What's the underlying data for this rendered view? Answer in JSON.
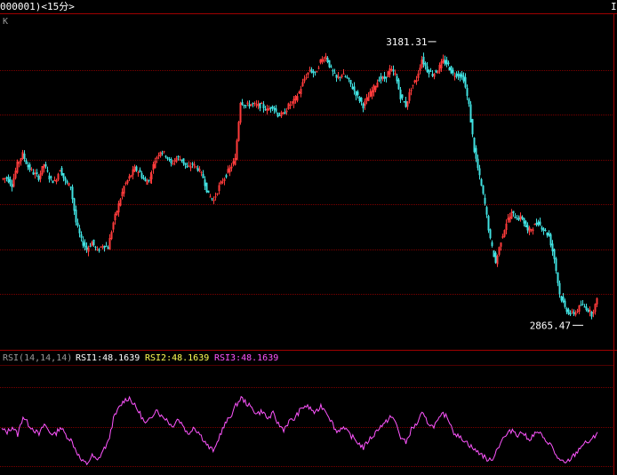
{
  "header": {
    "title": "000001)<15分>",
    "right_marker": "I"
  },
  "price_panel": {
    "label": "K",
    "high_label": "3181.31",
    "low_label": "2865.47"
  },
  "rsi_panel": {
    "params": "RSI(14,14,14)",
    "rsi1": "RSI1:48.1639",
    "rsi2": "RSI2:48.1639",
    "rsi3": "RSI3:48.1639"
  },
  "colors": {
    "background": "#000000",
    "grid": "#7a0000",
    "frame": "#a00000",
    "up_candle": "#ff3b3b",
    "down_candle": "#41e1e1",
    "rsi_line": "#ff55ff",
    "rsi1_text": "#ffffff",
    "rsi2_text": "#ffff55",
    "rsi3_text": "#ff55ff",
    "text": "#ffffff"
  },
  "chart_data": [
    {
      "type": "candlestick",
      "ylim": [
        2850,
        3200
      ],
      "x": [
        0,
        6,
        12,
        18,
        24,
        30,
        36,
        42,
        48,
        54,
        60,
        66,
        72,
        78,
        84,
        90,
        96,
        102,
        108,
        114,
        120,
        126,
        132,
        138,
        144,
        150,
        156,
        162,
        168,
        174,
        180,
        186,
        192,
        198,
        204,
        210,
        216,
        222,
        228,
        234,
        240,
        246,
        252,
        258,
        264,
        270,
        276,
        282,
        288,
        294,
        300,
        306,
        312,
        318,
        324,
        330,
        336,
        342,
        348,
        354,
        360,
        366,
        372,
        378,
        384,
        390,
        396,
        402,
        408,
        414,
        420,
        426,
        432,
        438,
        444,
        450,
        456,
        462,
        468,
        474,
        480,
        486,
        492,
        498,
        504,
        510,
        516,
        522,
        528,
        534,
        540,
        546,
        552,
        558,
        564,
        570,
        576,
        582,
        588,
        594,
        600,
        606,
        612,
        618,
        624,
        630,
        636,
        642,
        648,
        654,
        660,
        666,
        672
      ],
      "close": [
        3028,
        3030,
        3022,
        3045,
        3056,
        3042,
        3035,
        3030,
        3045,
        3030,
        3025,
        3040,
        3025,
        3020,
        2980,
        2960,
        2950,
        2958,
        2948,
        2955,
        2952,
        2980,
        3000,
        3020,
        3030,
        3040,
        3035,
        3025,
        3030,
        3050,
        3060,
        3055,
        3045,
        3052,
        3050,
        3040,
        3045,
        3040,
        3030,
        3010,
        3005,
        3020,
        3030,
        3040,
        3050,
        3115,
        3110,
        3112,
        3110,
        3110,
        3105,
        3110,
        3100,
        3100,
        3110,
        3115,
        3125,
        3140,
        3150,
        3145,
        3160,
        3165,
        3150,
        3140,
        3145,
        3140,
        3130,
        3120,
        3110,
        3120,
        3130,
        3140,
        3140,
        3150,
        3145,
        3120,
        3110,
        3130,
        3140,
        3162,
        3150,
        3145,
        3150,
        3160,
        3155,
        3145,
        3145,
        3140,
        3110,
        3060,
        3030,
        3000,
        2960,
        2935,
        2960,
        2980,
        2990,
        2985,
        2985,
        2970,
        2975,
        2980,
        2972,
        2965,
        2940,
        2900,
        2885,
        2878,
        2880,
        2888,
        2885,
        2878,
        2893
      ],
      "annotations": [
        {
          "text_key": "high_label",
          "x": 486,
          "y": 3181.31
        },
        {
          "text_key": "low_label",
          "x": 654,
          "y": 2865.47
        }
      ]
    },
    {
      "type": "line",
      "series": [
        {
          "name": "RSI",
          "x": [
            0,
            6,
            12,
            18,
            24,
            30,
            36,
            42,
            48,
            54,
            60,
            66,
            72,
            78,
            84,
            90,
            96,
            102,
            108,
            114,
            120,
            126,
            132,
            138,
            144,
            150,
            156,
            162,
            168,
            174,
            180,
            186,
            192,
            198,
            204,
            210,
            216,
            222,
            228,
            234,
            240,
            246,
            252,
            258,
            264,
            270,
            276,
            282,
            288,
            294,
            300,
            306,
            312,
            318,
            324,
            330,
            336,
            342,
            348,
            354,
            360,
            366,
            372,
            378,
            384,
            390,
            396,
            402,
            408,
            414,
            420,
            426,
            432,
            438,
            444,
            450,
            456,
            462,
            468,
            474,
            480,
            486,
            492,
            498,
            504,
            510,
            516,
            522,
            528,
            534,
            540,
            546,
            552,
            558,
            564,
            570,
            576,
            582,
            588,
            594,
            600,
            606,
            612,
            618,
            624,
            630,
            636,
            642,
            648,
            654,
            660,
            666,
            672
          ],
          "values": [
            48,
            46,
            50,
            44,
            58,
            52,
            48,
            44,
            52,
            46,
            44,
            50,
            44,
            40,
            32,
            24,
            22,
            28,
            24,
            32,
            38,
            56,
            64,
            70,
            72,
            66,
            60,
            52,
            56,
            64,
            58,
            56,
            50,
            56,
            52,
            44,
            50,
            46,
            40,
            34,
            32,
            44,
            52,
            58,
            66,
            72,
            68,
            64,
            60,
            62,
            56,
            60,
            52,
            48,
            54,
            56,
            62,
            66,
            64,
            60,
            66,
            62,
            54,
            46,
            50,
            46,
            42,
            38,
            34,
            40,
            44,
            50,
            52,
            58,
            54,
            42,
            38,
            48,
            52,
            60,
            54,
            50,
            54,
            60,
            56,
            46,
            42,
            40,
            36,
            32,
            30,
            26,
            24,
            32,
            40,
            44,
            48,
            44,
            46,
            40,
            44,
            46,
            40,
            38,
            30,
            24,
            22,
            26,
            30,
            36,
            38,
            40,
            46
          ]
        }
      ],
      "ylim": [
        0,
        100
      ]
    }
  ]
}
